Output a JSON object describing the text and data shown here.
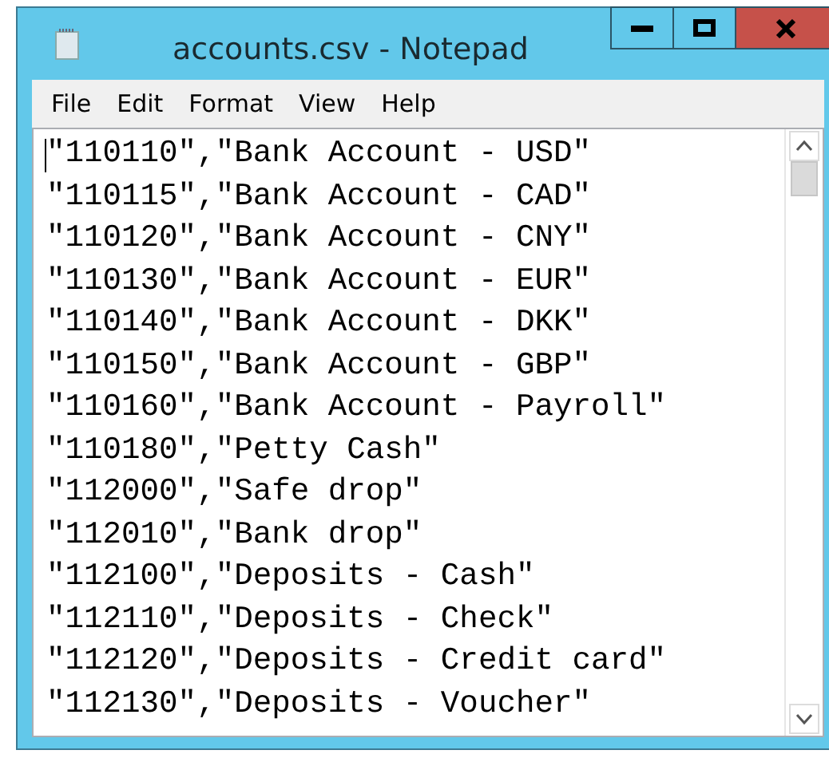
{
  "window": {
    "title": "accounts.csv - Notepad"
  },
  "menu": [
    "File",
    "Edit",
    "Format",
    "View",
    "Help"
  ],
  "lines": [
    "\"110110\",\"Bank Account - USD\"",
    "\"110115\",\"Bank Account - CAD\"",
    "\"110120\",\"Bank Account - CNY\"",
    "\"110130\",\"Bank Account - EUR\"",
    "\"110140\",\"Bank Account - DKK\"",
    "\"110150\",\"Bank Account - GBP\"",
    "\"110160\",\"Bank Account - Payroll\"",
    "\"110180\",\"Petty Cash\"",
    "\"112000\",\"Safe drop\"",
    "\"112010\",\"Bank drop\"",
    "\"112100\",\"Deposits - Cash\"",
    "\"112110\",\"Deposits - Check\"",
    "\"112120\",\"Deposits - Credit card\"",
    "\"112130\",\"Deposits - Voucher\""
  ]
}
